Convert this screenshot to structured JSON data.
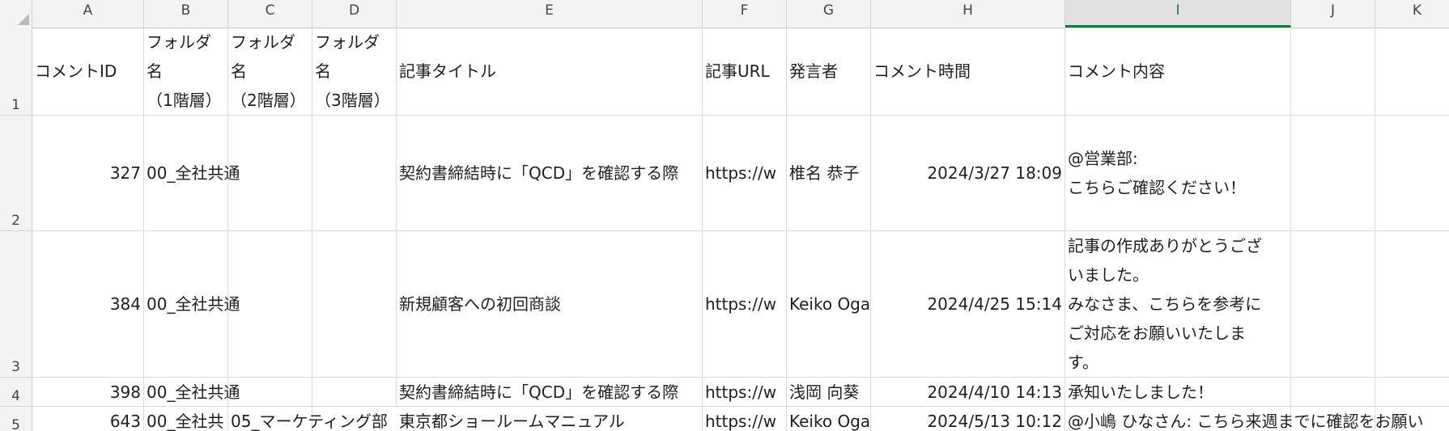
{
  "sheet": {
    "columns": [
      "A",
      "B",
      "C",
      "D",
      "E",
      "F",
      "G",
      "H",
      "I",
      "J",
      "K"
    ],
    "selected_column": "I",
    "rows": [
      "1",
      "2",
      "3",
      "4",
      "5"
    ],
    "header": {
      "a": "コメントID",
      "b": "フォルダ\n名\n（1階層）",
      "c": "フォルダ\n名\n（2階層）",
      "d": "フォルダ\n名\n（3階層）",
      "e": "記事タイトル",
      "f": "記事URL",
      "g": "発言者",
      "h": "コメント時間",
      "i": "コメント内容"
    },
    "data": [
      {
        "a": "327",
        "b": "00_全社共通",
        "c": "",
        "d": "",
        "e": "契約書締結時に「QCD」を確認する際",
        "f": "https://w",
        "g": "椎名 恭子",
        "h": "2024/3/27 18:09",
        "i": "@営業部:\nこちらご確認ください！"
      },
      {
        "a": "384",
        "b": "00_全社共通",
        "c": "",
        "d": "",
        "e": "新規顧客への初回商談",
        "f": "https://w",
        "g": "Keiko Oga",
        "h": "2024/4/25 15:14",
        "i": "記事の作成ありがとうござ\nいました。\nみなさま、こちらを参考に\nご対応をお願いいたしま\nす。"
      },
      {
        "a": "398",
        "b": "00_全社共通",
        "c": "",
        "d": "",
        "e": "契約書締結時に「QCD」を確認する際",
        "f": "https://w",
        "g": "浅岡 向葵",
        "h": "2024/4/10 14:13",
        "i": "承知いたしました！"
      },
      {
        "a": "643",
        "b": "00_全社共",
        "c": "05_マーケティング部",
        "d": "",
        "e": "東京都ショールームマニュアル",
        "f": "https://w",
        "g": "Keiko Oga",
        "h": "2024/5/13 10:12",
        "i": "@小嶋 ひなさん: こちら来週までに確認をお願い"
      }
    ]
  }
}
